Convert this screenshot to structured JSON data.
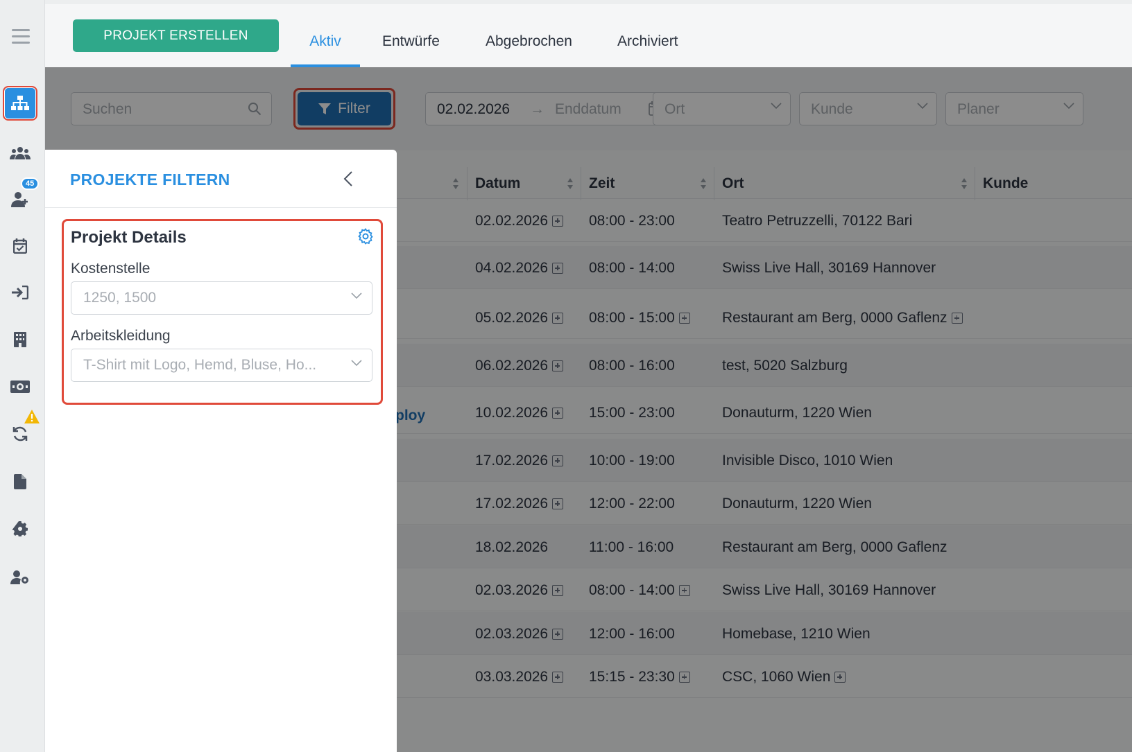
{
  "topbar": {
    "create_label": "PROJEKT ERSTELLEN",
    "tabs": [
      {
        "label": "Aktiv",
        "active": true
      },
      {
        "label": "Entwürfe"
      },
      {
        "label": "Abgebrochen"
      },
      {
        "label": "Archiviert"
      }
    ]
  },
  "sidenav": {
    "badge_count": "45",
    "items": [
      "projects-icon",
      "team-icon",
      "add-user-icon",
      "calendar-check-icon",
      "sign-in-icon",
      "building-icon",
      "money-icon",
      "sync-icon",
      "document-icon",
      "settings-icon",
      "user-settings-icon"
    ]
  },
  "filterbar": {
    "search_placeholder": "Suchen",
    "filter_label": "Filter",
    "date_start": "02.02.2026",
    "date_end_placeholder": "Enddatum",
    "location_placeholder": "Ort",
    "customer_placeholder": "Kunde",
    "planner_placeholder": "Planer"
  },
  "table": {
    "headers": {
      "date": "Datum",
      "time": "Zeit",
      "location": "Ort",
      "customer": "Kunde"
    },
    "link_fragment": "ploy",
    "rows": [
      {
        "date": "02.02.2026",
        "date_plus": true,
        "time": "08:00 - 23:00",
        "time_plus": false,
        "location": "Teatro Petruzzelli, 70122 Bari",
        "loc_plus": false
      },
      {
        "date": "04.02.2026",
        "date_plus": true,
        "time": "08:00 - 14:00",
        "time_plus": false,
        "location": "Swiss Live Hall, 30169 Hannover",
        "loc_plus": false
      },
      {
        "date": "05.02.2026",
        "date_plus": true,
        "time": "08:00 - 15:00",
        "time_plus": true,
        "location": "Restaurant am Berg, 0000 Gaflenz",
        "loc_plus": true
      },
      {
        "date": "06.02.2026",
        "date_plus": true,
        "time": "08:00 - 16:00",
        "time_plus": false,
        "location": "test, 5020 Salzburg",
        "loc_plus": false
      },
      {
        "date": "10.02.2026",
        "date_plus": true,
        "time": "15:00 - 23:00",
        "time_plus": false,
        "location": "Donauturm, 1220 Wien",
        "loc_plus": false
      },
      {
        "date": "17.02.2026",
        "date_plus": true,
        "time": "10:00 - 19:00",
        "time_plus": false,
        "location": "Invisible Disco, 1010 Wien",
        "loc_plus": false
      },
      {
        "date": "17.02.2026",
        "date_plus": true,
        "time": "12:00 - 22:00",
        "time_plus": false,
        "location": "Donauturm, 1220 Wien",
        "loc_plus": false
      },
      {
        "date": "18.02.2026",
        "date_plus": false,
        "time": "11:00 - 16:00",
        "time_plus": false,
        "location": "Restaurant am Berg, 0000 Gaflenz",
        "loc_plus": false
      },
      {
        "date": "02.03.2026",
        "date_plus": true,
        "time": "08:00 - 14:00",
        "time_plus": true,
        "location": "Swiss Live Hall, 30169 Hannover",
        "loc_plus": false
      },
      {
        "date": "02.03.2026",
        "date_plus": true,
        "time": "12:00 - 16:00",
        "time_plus": false,
        "location": "Homebase, 1210 Wien",
        "loc_plus": false
      },
      {
        "date": "03.03.2026",
        "date_plus": true,
        "time": "15:15 - 23:30",
        "time_plus": true,
        "location": "CSC, 1060 Wien",
        "loc_plus": true
      }
    ]
  },
  "panel": {
    "title": "PROJEKTE FILTERN",
    "section_title": "Projekt Details",
    "cost_center_label": "Kostenstelle",
    "cost_center_value": "1250, 1500",
    "workwear_label": "Arbeitskleidung",
    "workwear_value": "T-Shirt mit Logo, Hemd, Bluse, Ho..."
  }
}
